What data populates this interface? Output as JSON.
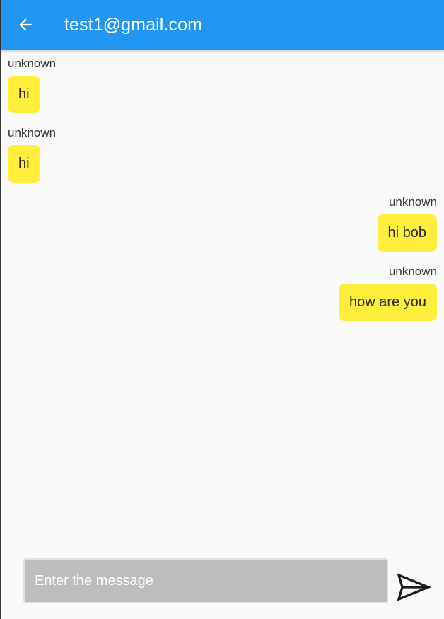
{
  "appbar": {
    "title": "test1@gmail.com",
    "back_icon": "arrow-back-icon",
    "background": "#2196f3"
  },
  "messages": [
    {
      "sender": "unknown",
      "text": "hi",
      "side": "left"
    },
    {
      "sender": "unknown",
      "text": "hi",
      "side": "left"
    },
    {
      "sender": "unknown",
      "text": "hi bob",
      "side": "right"
    },
    {
      "sender": "unknown",
      "text": "how are you",
      "side": "right"
    }
  ],
  "composer": {
    "placeholder": "Enter the message",
    "value": "",
    "send_icon": "send-icon"
  },
  "colors": {
    "bubble": "#ffee3b",
    "input_bg": "#bdbdbd"
  }
}
